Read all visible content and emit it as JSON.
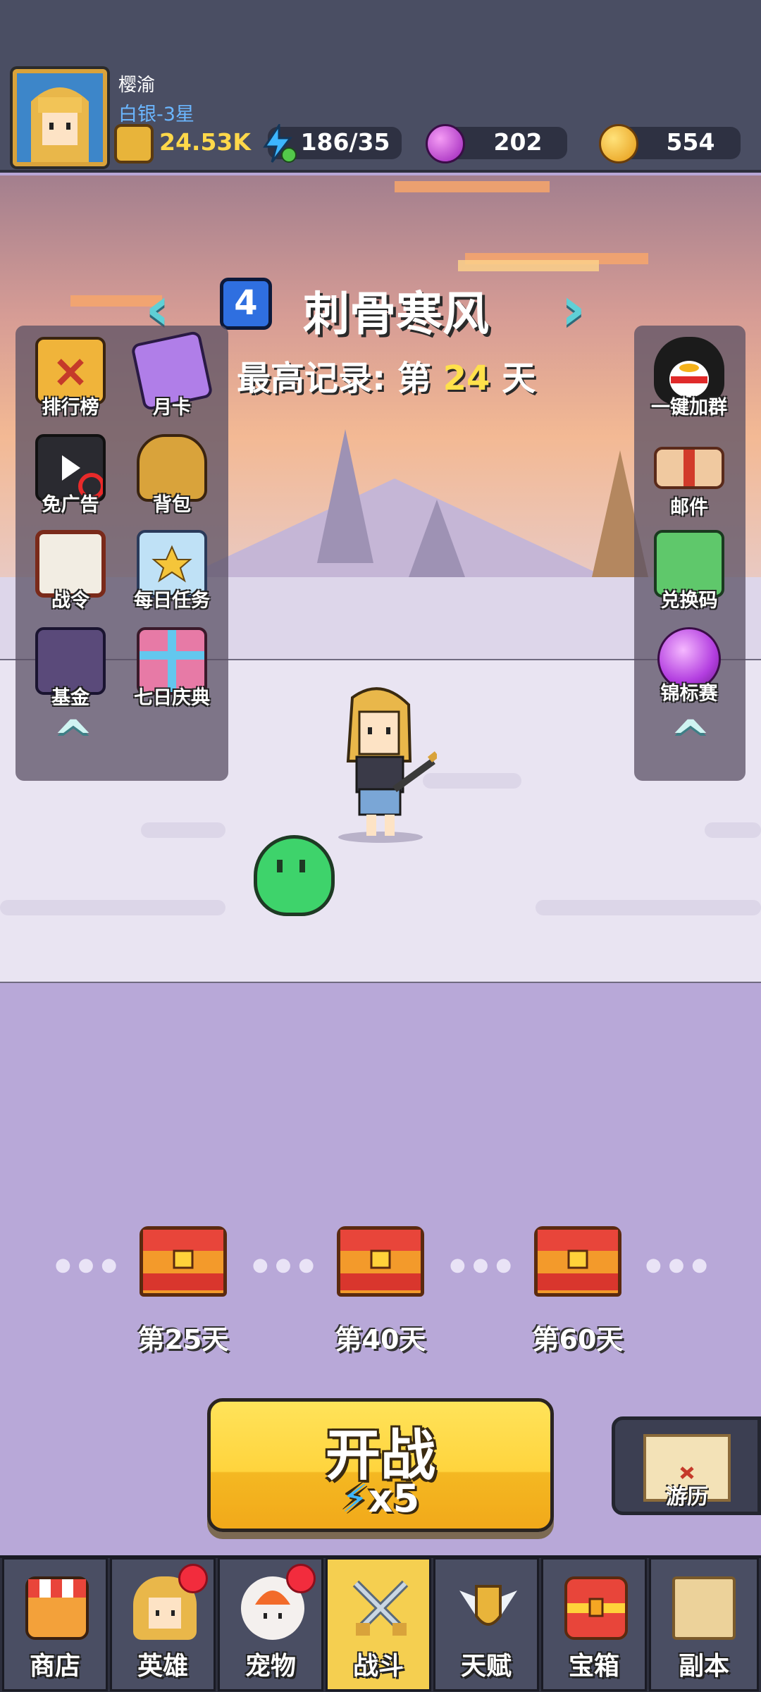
{
  "player": {
    "name": "樱渝",
    "rank": "白银-3星",
    "power": "24.53K",
    "energy": "186/35",
    "gems": "202",
    "coins": "554"
  },
  "stage": {
    "number": "4",
    "name": "刺骨寒风",
    "record_prefix": "最高记录: 第",
    "record_day": "24",
    "record_suffix": "天"
  },
  "left_menu": [
    {
      "label": "排行榜",
      "icon": "leaderboard-icon"
    },
    {
      "label": "月卡",
      "icon": "monthly-card-icon"
    },
    {
      "label": "免广告",
      "icon": "no-ads-icon"
    },
    {
      "label": "背包",
      "icon": "backpack-icon"
    },
    {
      "label": "战令",
      "icon": "battle-pass-icon"
    },
    {
      "label": "每日任务",
      "icon": "daily-tasks-icon"
    },
    {
      "label": "基金",
      "icon": "fund-icon"
    },
    {
      "label": "七日庆典",
      "icon": "seven-day-gift-icon"
    }
  ],
  "right_menu": [
    {
      "label": "一键加群",
      "icon": "qq-penguin-icon"
    },
    {
      "label": "邮件",
      "icon": "mail-scroll-icon"
    },
    {
      "label": "兑换码",
      "icon": "redeem-code-icon"
    },
    {
      "label": "锦标赛",
      "icon": "tournament-orb-icon"
    }
  ],
  "rewards": [
    {
      "label": "第25天",
      "icon": "treasure-chest-icon"
    },
    {
      "label": "第40天",
      "icon": "treasure-chest-icon"
    },
    {
      "label": "第60天",
      "icon": "treasure-chest-icon"
    }
  ],
  "battle": {
    "label": "开战",
    "cost": "x5",
    "cost_icon": "lightning-icon"
  },
  "travel": {
    "label": "游历",
    "icon": "map-icon"
  },
  "nav": [
    {
      "label": "商店",
      "icon": "shop-stall-icon",
      "active": false,
      "badge": false
    },
    {
      "label": "英雄",
      "icon": "hero-icon",
      "active": false,
      "badge": true
    },
    {
      "label": "宠物",
      "icon": "pet-rabbit-icon",
      "active": false,
      "badge": true
    },
    {
      "label": "战斗",
      "icon": "crossed-swords-icon",
      "active": true,
      "badge": false
    },
    {
      "label": "天赋",
      "icon": "talent-wings-icon",
      "active": false,
      "badge": false
    },
    {
      "label": "宝箱",
      "icon": "chest-icon",
      "active": false,
      "badge": false
    },
    {
      "label": "副本",
      "icon": "dungeon-map-icon",
      "active": false,
      "badge": false
    }
  ],
  "colors": {
    "topbar": "#4a4e63",
    "accent_yellow": "#ffd43d",
    "rank_blue": "#6bb6ff",
    "badge_red": "#f22c3d"
  }
}
